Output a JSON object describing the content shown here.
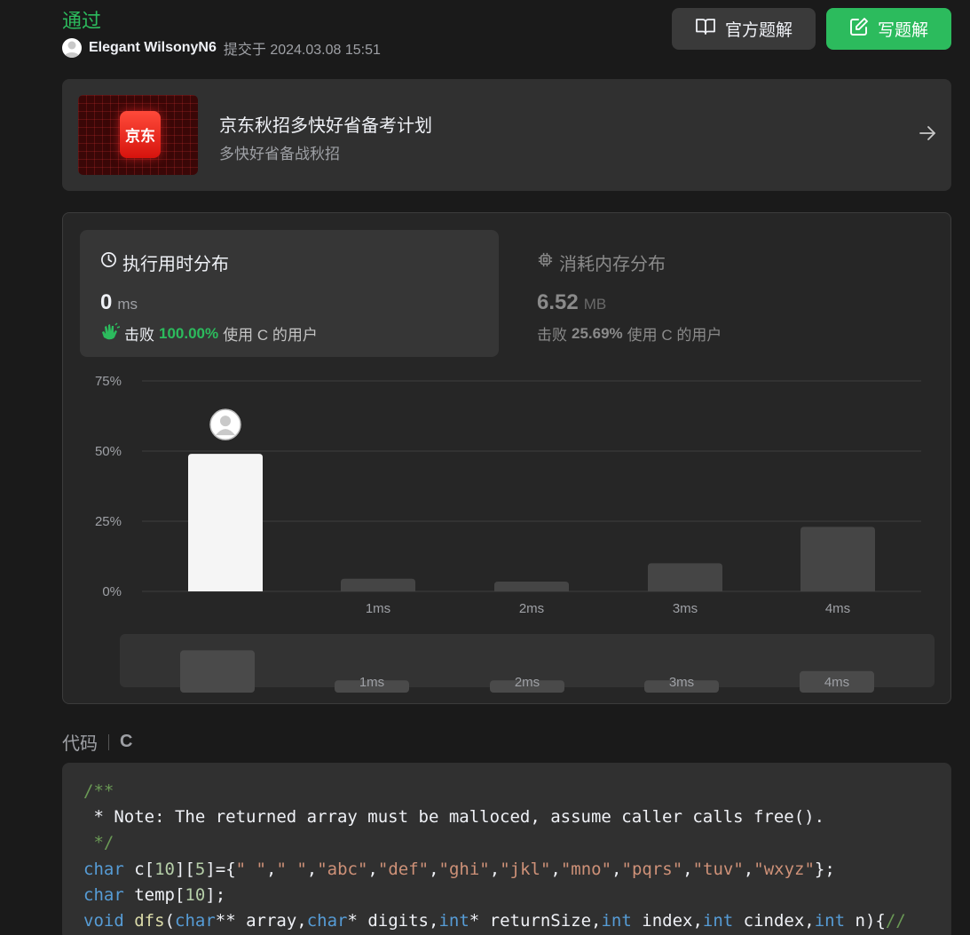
{
  "header": {
    "status": "通过",
    "user_name": "Elegant WilsonyN6",
    "submit_text": "提交于 2024.03.08 15:51",
    "btn_official": "官方题解",
    "btn_write": "写题解"
  },
  "banner": {
    "logo_text": "京东",
    "title": "京东秋招多快好省备考计划",
    "subtitle": "多快好省备战秋招"
  },
  "runtime": {
    "title": "执行用时分布",
    "value": "0",
    "unit": "ms",
    "beat_label": "击败",
    "beat_pct": "100.00%",
    "beat_suffix": "使用 C 的用户"
  },
  "memory": {
    "title": "消耗内存分布",
    "value": "6.52",
    "unit": "MB",
    "beat_label": "击败",
    "beat_pct": "25.69%",
    "beat_suffix": "使用 C 的用户"
  },
  "chart_data": {
    "type": "bar",
    "categories": [
      "",
      "1ms",
      "2ms",
      "3ms",
      "4ms"
    ],
    "values": [
      49,
      4.5,
      3.5,
      10,
      23
    ],
    "ylim": [
      0,
      75
    ],
    "y_ticks": [
      "0%",
      "25%",
      "50%",
      "75%"
    ],
    "highlight_index": 0,
    "colors": {
      "highlight": "#f5f5f5",
      "bar": "#454545",
      "grid": "#3e3e3e",
      "mini_bar": "#4a4a4a"
    },
    "mini_values": [
      16,
      3,
      3,
      3,
      7
    ]
  },
  "code": {
    "label": "代码",
    "language": "C"
  },
  "colors": {
    "accent": "#2cbb5d"
  }
}
